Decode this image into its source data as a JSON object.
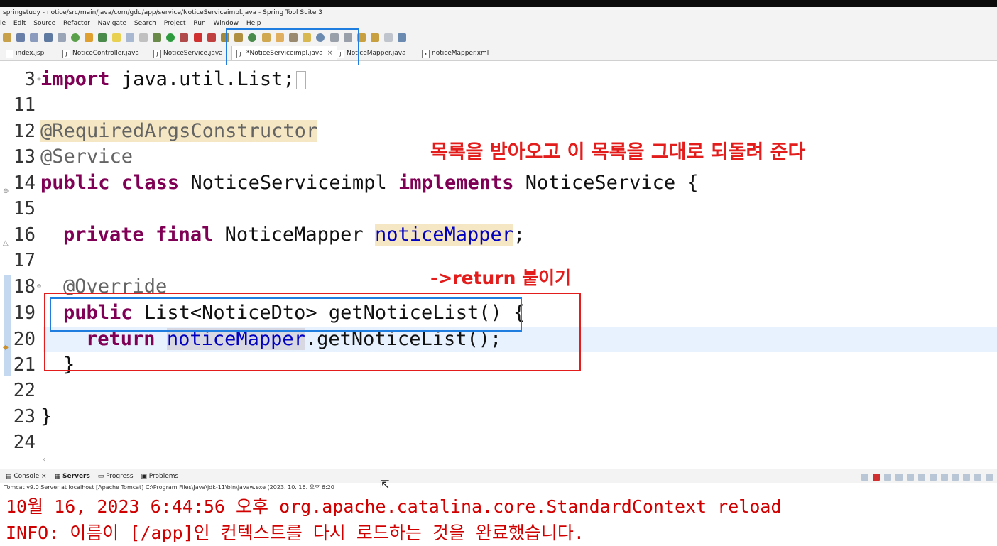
{
  "window": {
    "title": "springstudy - notice/src/main/java/com/gdu/app/service/NoticeServiceimpl.java - Spring Tool Suite 3"
  },
  "menu": [
    "le",
    "Edit",
    "Source",
    "Refactor",
    "Navigate",
    "Search",
    "Project",
    "Run",
    "Window",
    "Help"
  ],
  "tabs": [
    {
      "label": "index.jsp",
      "active": false
    },
    {
      "label": "NoticeController.java",
      "active": false
    },
    {
      "label": "NoticeService.java",
      "active": false
    },
    {
      "label": "*NoticeServiceimpl.java",
      "active": true,
      "close": "×"
    },
    {
      "label": "NoticeMapper.java",
      "active": false
    },
    {
      "label": "noticeMapper.xml",
      "active": false
    }
  ],
  "editor": {
    "lines": [
      {
        "num": "3",
        "tokens": [
          [
            "kw",
            "import"
          ],
          [
            "",
            "java.util.List;"
          ]
        ]
      },
      {
        "num": "11",
        "tokens": []
      },
      {
        "num": "12",
        "tokens": [
          [
            "ann-hl",
            "@RequiredArgsConstructor"
          ]
        ]
      },
      {
        "num": "13",
        "tokens": [
          [
            "ann",
            "@Service"
          ]
        ]
      },
      {
        "num": "14",
        "tokens": [
          [
            "kw",
            "public"
          ],
          [
            "kw",
            "class"
          ],
          [
            "",
            "NoticeServiceimpl"
          ],
          [
            "kw",
            "implements"
          ],
          [
            "",
            "NoticeService {"
          ]
        ]
      },
      {
        "num": "15",
        "tokens": []
      },
      {
        "num": "16",
        "tokens": [
          [
            "kw",
            "private"
          ],
          [
            "kw",
            "final"
          ],
          [
            "",
            "NoticeMapper"
          ],
          [
            "var-hl",
            "noticeMapper"
          ],
          [
            ";",
            " "
          ]
        ]
      },
      {
        "num": "17",
        "tokens": []
      },
      {
        "num": "18",
        "tokens": [
          [
            "ann",
            "@Override"
          ]
        ]
      },
      {
        "num": "19",
        "tokens": [
          [
            "kw",
            "public"
          ],
          [
            "",
            "List<NoticeDto> getNoticeList() {"
          ]
        ]
      },
      {
        "num": "20",
        "tokens": [
          [
            "kw",
            "return"
          ],
          [
            "field-sel",
            "noticeMapper"
          ],
          [
            "",
            ".getNoticeList();"
          ]
        ]
      },
      {
        "num": "21",
        "tokens": [
          [
            "",
            "}"
          ]
        ]
      },
      {
        "num": "22",
        "tokens": []
      },
      {
        "num": "23",
        "tokens": [
          [
            "",
            "}"
          ]
        ]
      },
      {
        "num": "24",
        "tokens": []
      }
    ]
  },
  "annotations": {
    "note1": "목록을 받아오고 이 목록을 그대로 되돌려 준다",
    "note2": "->return 붙이기"
  },
  "bottom": {
    "tabs": [
      "Console",
      "Servers",
      "Progress",
      "Problems"
    ],
    "console_close": "×",
    "console_header": "Tomcat v9.0 Server at localhost [Apache Tomcat] C:\\Program Files\\Java\\jdk-11\\bin\\javaw.exe  (2023. 10. 16. 오후 6:20",
    "console_lines": [
      "10월 16, 2023 6:44:56 오후 org.apache.catalina.core.StandardContext reload",
      "INFO: 이름이 [/app]인 컨텍스트를 다시 로드하는 것을 완료했습니다."
    ]
  },
  "colors": {
    "keyword": "#7f0055",
    "annotation_text": "#e31c1c",
    "highlight_blue_box": "#1f7de0",
    "highlight_red_box": "#e31c1c",
    "console_text": "#d10000"
  }
}
